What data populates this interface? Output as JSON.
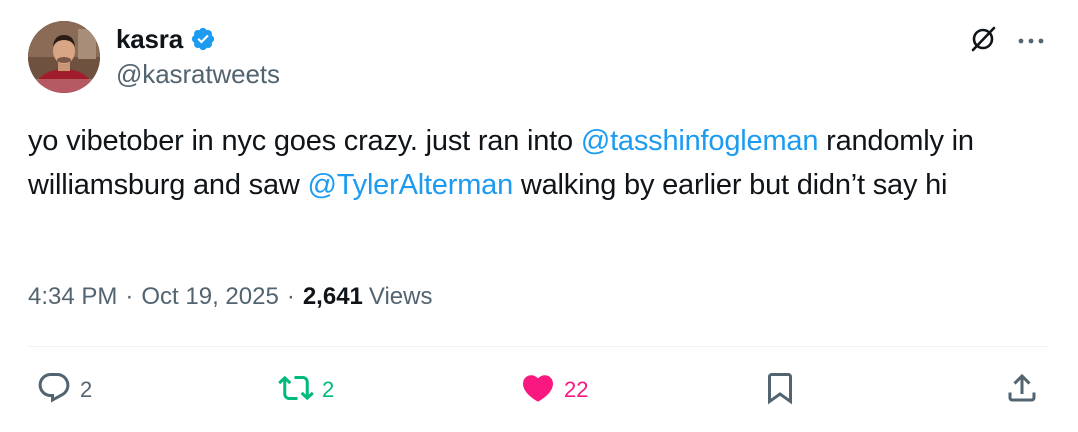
{
  "author": {
    "display_name": "kasra",
    "handle": "@kasratweets",
    "verified": true
  },
  "tweet": {
    "segments": [
      {
        "type": "text",
        "value": "yo vibetober in nyc goes crazy. just ran into "
      },
      {
        "type": "mention",
        "value": "@tasshinfogleman"
      },
      {
        "type": "text",
        "value": " randomly in williamsburg and saw "
      },
      {
        "type": "mention",
        "value": "@TylerAlterman"
      },
      {
        "type": "text",
        "value": " walking by earlier but didn’t say hi"
      }
    ]
  },
  "meta": {
    "time": "4:34 PM",
    "separator": "·",
    "date": "Oct 19, 2025",
    "views_count": "2,641",
    "views_label": "Views"
  },
  "actions": {
    "replies": "2",
    "retweets": "2",
    "likes": "22"
  },
  "colors": {
    "accent": "#1d9bf0",
    "retweet_green": "#00ba7c",
    "like_pink": "#f91880",
    "muted": "#536471"
  },
  "icons": {
    "header": [
      "grok-icon",
      "more-icon"
    ],
    "actions": [
      "reply-icon",
      "retweet-icon",
      "heart-icon",
      "bookmark-icon",
      "share-icon"
    ]
  }
}
